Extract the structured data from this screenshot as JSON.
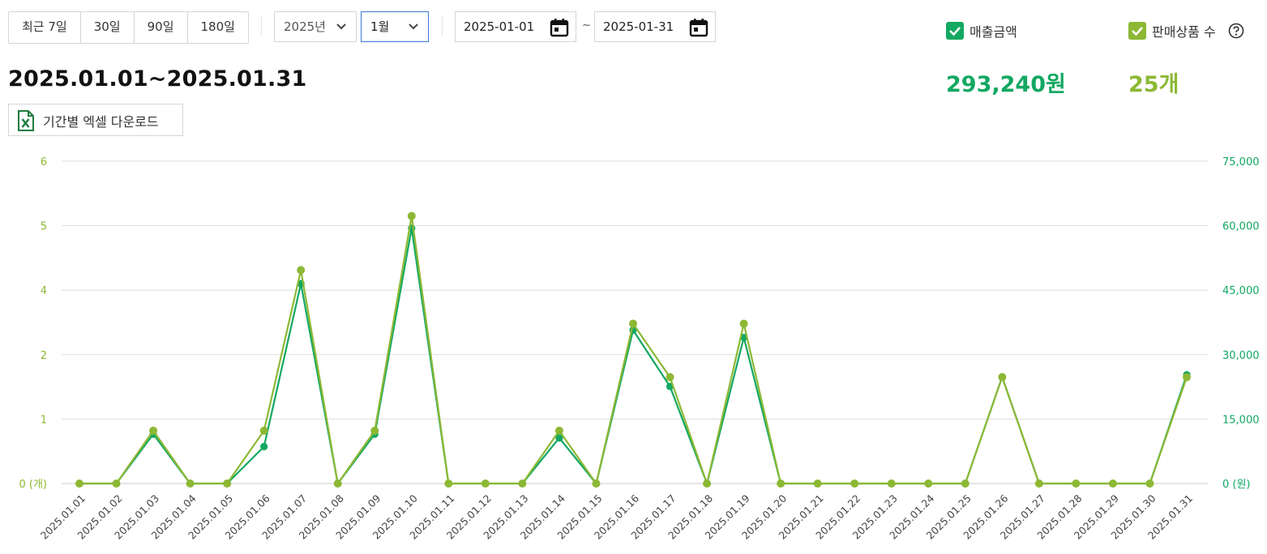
{
  "period_buttons": [
    "최근 7일",
    "30일",
    "90일",
    "180일"
  ],
  "year_select": {
    "value": "2025년"
  },
  "month_select": {
    "value": "1월"
  },
  "date_range": {
    "start": "2025-01-01",
    "tilde": "~",
    "end": "2025-01-31"
  },
  "toggles": {
    "sales": {
      "label": "매출금액",
      "checked": true,
      "color": "#13a862"
    },
    "items": {
      "label": "판매상품 수",
      "checked": true,
      "color": "#8cb834"
    }
  },
  "help_icon": "question-circle-icon",
  "summary": {
    "range_title": "2025.01.01~2025.01.31",
    "sales_total": "293,240원",
    "items_total": "25개"
  },
  "excel_button": {
    "label": "기간별 엑셀 다운로드",
    "icon": "excel-file-icon"
  },
  "colors": {
    "sales": "#13a862",
    "items": "#8cb834",
    "grid": "#dedede"
  },
  "chart_data": {
    "type": "line",
    "x": [
      "2025.01.01",
      "2025.01.02",
      "2025.01.03",
      "2025.01.04",
      "2025.01.05",
      "2025.01.06",
      "2025.01.07",
      "2025.01.08",
      "2025.01.09",
      "2025.01.10",
      "2025.01.11",
      "2025.01.12",
      "2025.01.13",
      "2025.01.14",
      "2025.01.15",
      "2025.01.16",
      "2025.01.17",
      "2025.01.18",
      "2025.01.19",
      "2025.01.20",
      "2025.01.21",
      "2025.01.22",
      "2025.01.23",
      "2025.01.24",
      "2025.01.25",
      "2025.01.26",
      "2025.01.27",
      "2025.01.28",
      "2025.01.29",
      "2025.01.30",
      "2025.01.31"
    ],
    "left_axis": {
      "ticks": [
        0,
        1,
        2,
        3,
        4,
        5
      ],
      "tick_labels": [
        "0 (개)",
        "1",
        "2",
        "4",
        "5",
        "6"
      ],
      "ylim": [
        0,
        5
      ]
    },
    "right_axis": {
      "ticks": [
        0,
        15000,
        30000,
        45000,
        60000,
        75000
      ],
      "tick_labels": [
        "0 (원)",
        "15,000",
        "30,000",
        "45,000",
        "60,000",
        "75,000"
      ],
      "ylim": [
        0,
        75000
      ]
    },
    "series": [
      {
        "name": "매출금액",
        "axis": "right",
        "values": [
          0,
          0,
          11500,
          0,
          0,
          8600,
          46500,
          0,
          11500,
          59400,
          0,
          0,
          0,
          10600,
          0,
          35700,
          22600,
          0,
          34000,
          0,
          0,
          0,
          0,
          0,
          0,
          24800,
          0,
          0,
          0,
          0,
          25300
        ]
      },
      {
        "name": "판매상품 수",
        "axis": "left",
        "values": [
          0,
          0,
          0.82,
          0,
          0,
          0.82,
          3.31,
          0,
          0.82,
          4.15,
          0,
          0,
          0,
          0.82,
          0,
          2.48,
          1.65,
          0,
          2.48,
          0,
          0,
          0,
          0,
          0,
          0,
          1.65,
          0,
          0,
          0,
          0,
          1.65
        ]
      }
    ],
    "grid": true,
    "legend": "top-right"
  }
}
